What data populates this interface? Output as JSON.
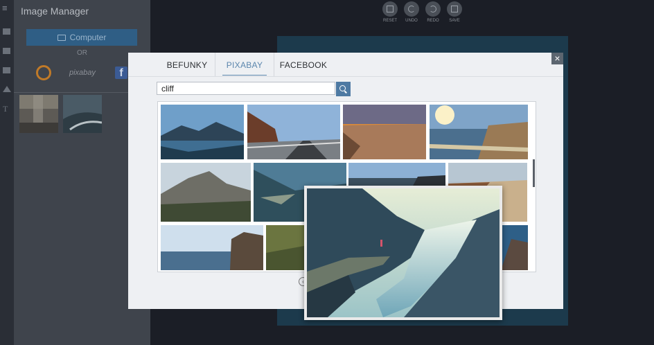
{
  "panel": {
    "title": "Image Manager",
    "computer_label": "Computer",
    "or_label": "OR",
    "pixabay_label": "pixabay",
    "facebook_glyph": "f"
  },
  "toolbar": {
    "reset": "RESET",
    "undo": "UNDO",
    "redo": "REDO",
    "save": "SAVE"
  },
  "modal": {
    "tabs": [
      "BEFUNKY",
      "PIXABAY",
      "FACEBOOK"
    ],
    "active_tab": "PIXABAY",
    "search_value": "cliff",
    "close_glyph": "×",
    "pager_glyph": "‹"
  },
  "colors": {
    "accent": "#5b86ad",
    "panel": "#3f444c",
    "search_button": "#4e7aa3"
  }
}
